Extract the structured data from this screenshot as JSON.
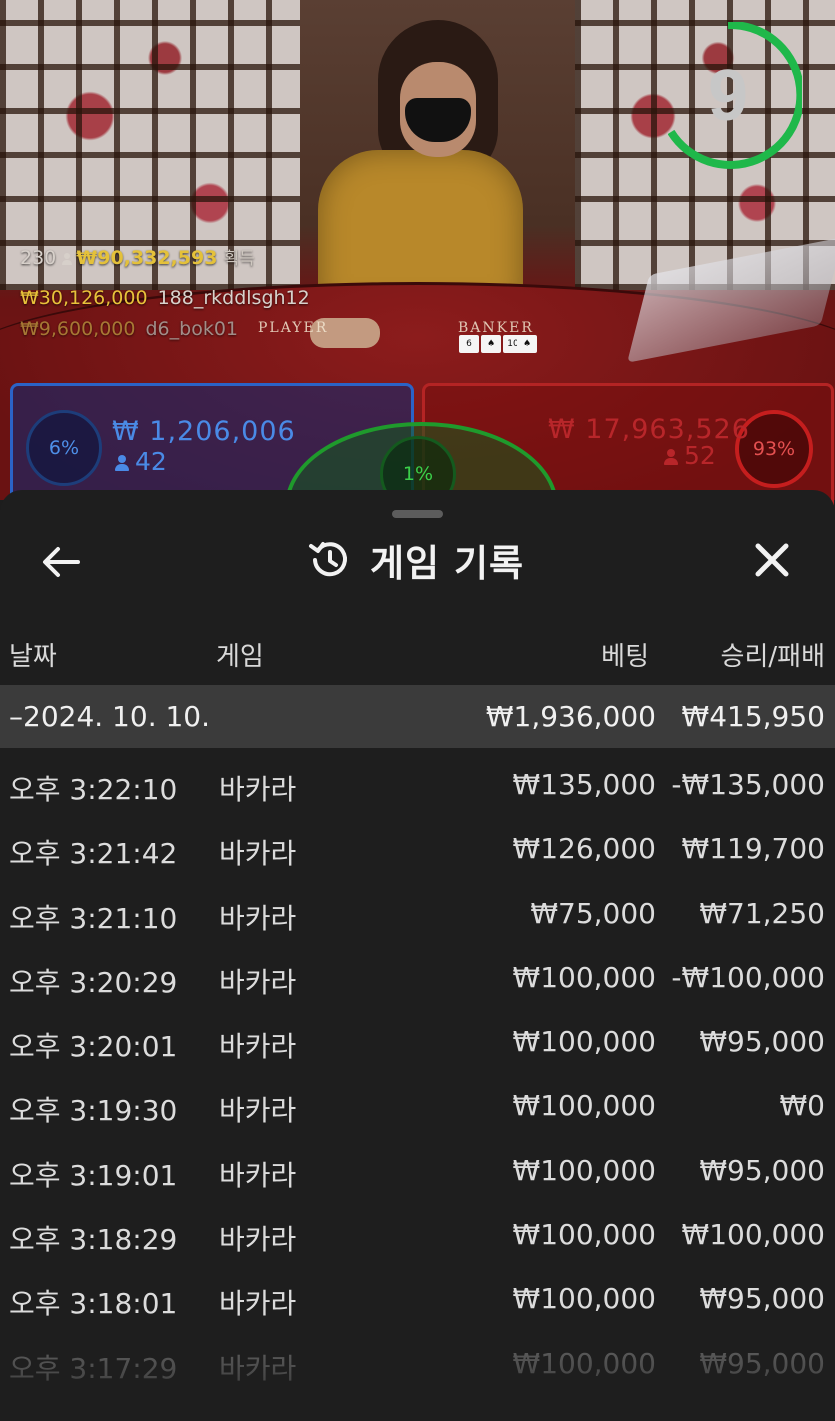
{
  "stream": {
    "timer": "9",
    "overlay": {
      "player_count": "230",
      "total_win": "₩90,332,593",
      "total_win_suffix": "획득",
      "winners": [
        {
          "amount": "₩30,126,000",
          "user": "188_rkddlsgh12"
        },
        {
          "amount": "₩9,600,000",
          "user": "d6_bok01"
        }
      ]
    },
    "felt": {
      "player": "PLAYER",
      "banker": "BANKER"
    },
    "bets": {
      "player": {
        "percent": "6%",
        "amount": "₩ 1,206,006",
        "count": "42"
      },
      "tie": {
        "percent": "1%"
      },
      "banker": {
        "percent": "93%",
        "amount": "₩ 17,963,526",
        "count": "52"
      }
    },
    "colors": {
      "player": "#2b63c7",
      "banker": "#b42424",
      "tie": "#1f9a2c",
      "timer": "#1fb84a"
    }
  },
  "sheet": {
    "title": "게임 기록",
    "icons": {
      "back": "arrow-left-icon",
      "history": "history-icon",
      "close": "close-icon"
    },
    "columns": {
      "date": "날짜",
      "game": "게임",
      "bet": "베팅",
      "result": "승리/패배"
    },
    "summary": {
      "date": "–2024. 10. 10.",
      "bet": "₩1,936,000",
      "result": "₩415,950"
    },
    "rows": [
      {
        "time": "오후 3:22:10",
        "game": "바카라",
        "bet": "₩135,000",
        "result": "-₩135,000"
      },
      {
        "time": "오후 3:21:42",
        "game": "바카라",
        "bet": "₩126,000",
        "result": "₩119,700"
      },
      {
        "time": "오후 3:21:10",
        "game": "바카라",
        "bet": "₩75,000",
        "result": "₩71,250"
      },
      {
        "time": "오후 3:20:29",
        "game": "바카라",
        "bet": "₩100,000",
        "result": "-₩100,000"
      },
      {
        "time": "오후 3:20:01",
        "game": "바카라",
        "bet": "₩100,000",
        "result": "₩95,000"
      },
      {
        "time": "오후 3:19:30",
        "game": "바카라",
        "bet": "₩100,000",
        "result": "₩0"
      },
      {
        "time": "오후 3:19:01",
        "game": "바카라",
        "bet": "₩100,000",
        "result": "₩95,000"
      },
      {
        "time": "오후 3:18:29",
        "game": "바카라",
        "bet": "₩100,000",
        "result": "₩100,000"
      },
      {
        "time": "오후 3:18:01",
        "game": "바카라",
        "bet": "₩100,000",
        "result": "₩95,000"
      },
      {
        "time": "오후 3:17:29",
        "game": "바카라",
        "bet": "₩100,000",
        "result": "₩95,000"
      }
    ]
  }
}
